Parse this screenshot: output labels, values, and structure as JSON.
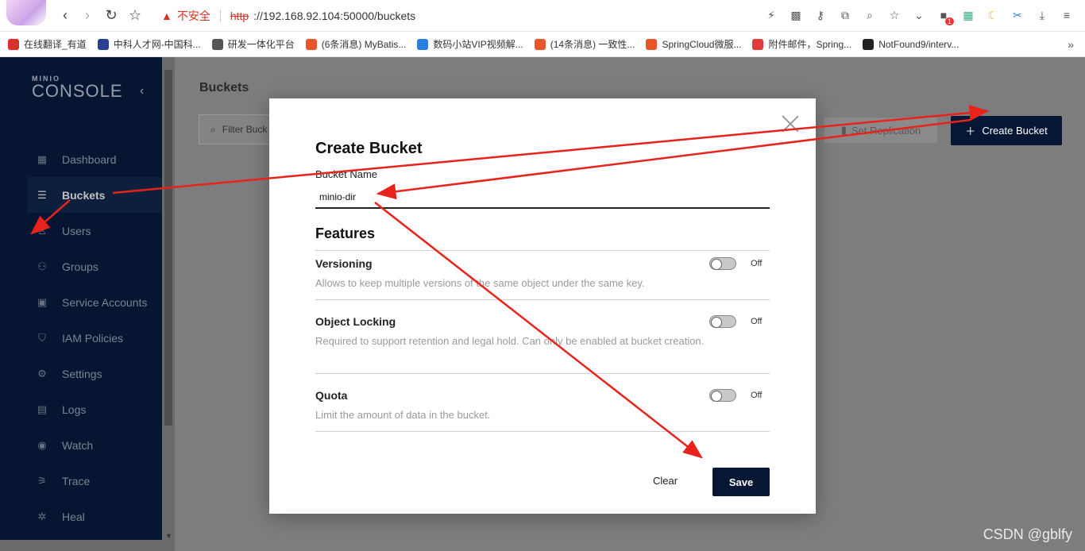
{
  "browser": {
    "security_label": "不安全",
    "url_scheme": "http",
    "url_rest": "://192.168.92.104:50000/buckets",
    "extension_badge": "1"
  },
  "bookmarks": [
    {
      "label": "在线翻译_有道",
      "color": "#d8312c"
    },
    {
      "label": "中科人才网-中国科...",
      "color": "#2a3f8f"
    },
    {
      "label": "研发一体化平台",
      "color": "#555555"
    },
    {
      "label": "(6条消息) MyBatis...",
      "color": "#e8552b"
    },
    {
      "label": "数码小站VIP视频解...",
      "color": "#2a7de1"
    },
    {
      "label": "(14条消息) 一致性...",
      "color": "#e8552b"
    },
    {
      "label": "SpringCloud微服...",
      "color": "#e8552b"
    },
    {
      "label": "附件邮件，Spring...",
      "color": "#e23b3b"
    },
    {
      "label": "NotFound9/interv...",
      "color": "#222222"
    }
  ],
  "sidebar": {
    "logo_small": "MINIO",
    "logo_big": "CONSOLE",
    "items": [
      {
        "label": "Dashboard",
        "icon": "dashboard-icon",
        "glyph": "▦"
      },
      {
        "label": "Buckets",
        "icon": "bucket-icon",
        "glyph": "☰",
        "active": true
      },
      {
        "label": "Users",
        "icon": "user-icon",
        "glyph": "♙"
      },
      {
        "label": "Groups",
        "icon": "groups-icon",
        "glyph": "⚇"
      },
      {
        "label": "Service Accounts",
        "icon": "service-accounts-icon",
        "glyph": "▣"
      },
      {
        "label": "IAM Policies",
        "icon": "shield-icon",
        "glyph": "⛉"
      },
      {
        "label": "Settings",
        "icon": "gear-icon",
        "glyph": "⚙"
      },
      {
        "label": "Logs",
        "icon": "logs-icon",
        "glyph": "▤"
      },
      {
        "label": "Watch",
        "icon": "watch-icon",
        "glyph": "◉"
      },
      {
        "label": "Trace",
        "icon": "trace-icon",
        "glyph": "⚞"
      },
      {
        "label": "Heal",
        "icon": "heal-icon",
        "glyph": "✲"
      }
    ]
  },
  "main": {
    "title": "Buckets",
    "filter_placeholder": "Filter Buck",
    "set_replication": "Set Replication",
    "create_bucket": "Create Bucket"
  },
  "modal": {
    "title": "Create Bucket",
    "name_label": "Bucket Name",
    "name_value": "minio-dir",
    "features_title": "Features",
    "features": [
      {
        "name": "Versioning",
        "desc": "Allows to keep multiple versions of the same object under the same key.",
        "state": "Off"
      },
      {
        "name": "Object Locking",
        "desc": "Required to support retention and legal hold. Can only be enabled at bucket creation.",
        "state": "Off"
      },
      {
        "name": "Quota",
        "desc": "Limit the amount of data in the bucket.",
        "state": "Off"
      }
    ],
    "clear_label": "Clear",
    "save_label": "Save"
  },
  "annotation_color": "#e8231c",
  "watermark": "CSDN @gblfy"
}
